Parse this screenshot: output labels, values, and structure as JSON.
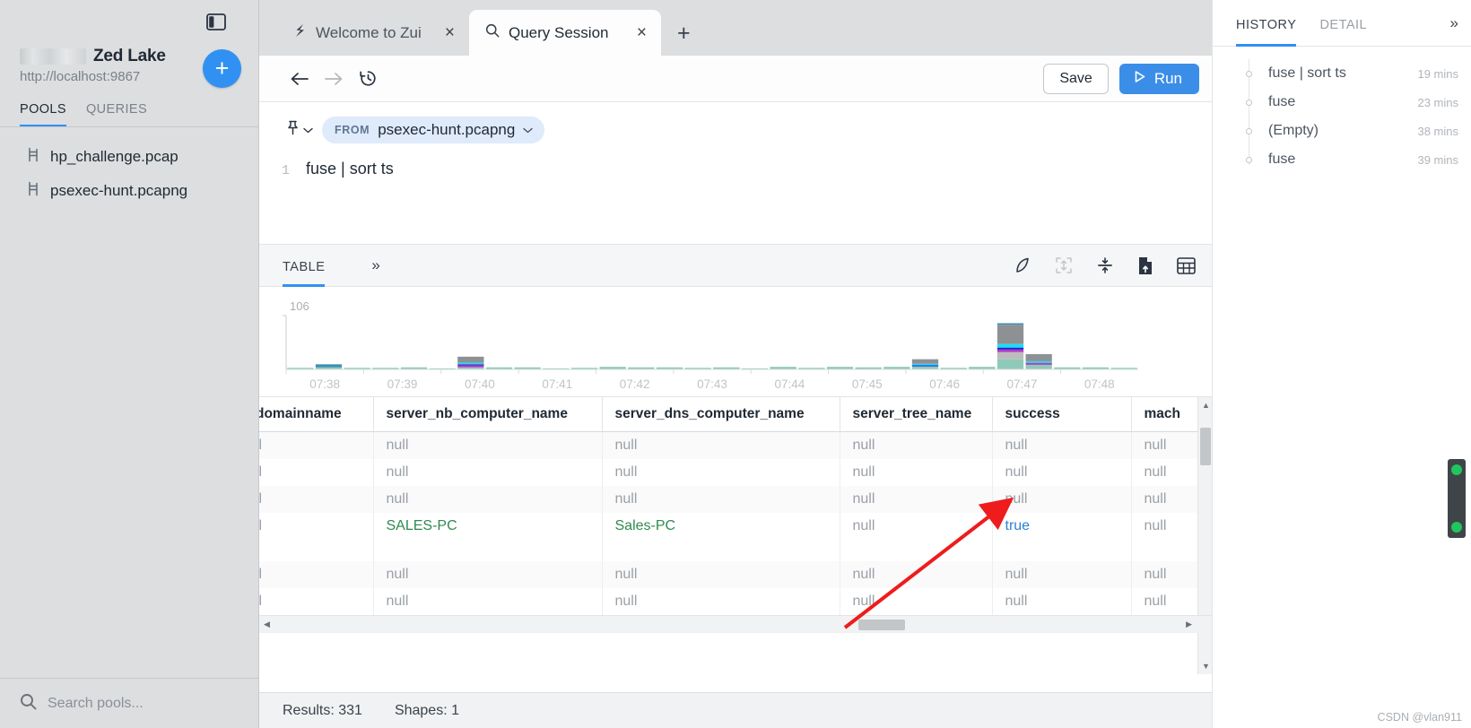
{
  "sidebar": {
    "panel_toggle_icon": "panel-toggle-icon",
    "lake_name": "Zed Lake",
    "lake_url": "http://localhost:9867",
    "add_button_label": "+",
    "tabs": [
      {
        "label": "POOLS",
        "active": true
      },
      {
        "label": "QUERIES",
        "active": false
      }
    ],
    "pools": [
      {
        "label": "hp_challenge.pcap",
        "icon": "pool-icon"
      },
      {
        "label": "psexec-hunt.pcapng",
        "icon": "pool-icon"
      }
    ],
    "search": {
      "placeholder": "Search pools...",
      "icon": "search-icon"
    }
  },
  "tabstrip": {
    "tabs": [
      {
        "label": "Welcome to Zui",
        "icon": "zui-logo-icon",
        "close": "×",
        "active": false
      },
      {
        "label": "Query Session",
        "icon": "search-icon",
        "close": "×",
        "active": true
      }
    ],
    "new_tab_label": "+"
  },
  "toolbar": {
    "back_icon": "arrow-left-icon",
    "forward_icon": "arrow-right-icon",
    "history_icon": "clock-history-icon",
    "save_label": "Save",
    "run_label": "Run",
    "run_icon": "play-icon"
  },
  "editor": {
    "pin_icon": "pin-icon",
    "pin_chevron": "chevron-down-icon",
    "from_keyword": "FROM",
    "from_value": "psexec-hunt.pcapng",
    "from_chevron": "chevron-down-icon",
    "line_number": "1",
    "query_text": "fuse | sort ts"
  },
  "results": {
    "tabs": [
      {
        "label": "TABLE",
        "active": true
      }
    ],
    "more_icon": "chevron-double-right-icon",
    "tools": [
      {
        "name": "shark-fin-icon"
      },
      {
        "name": "expand-arrows-icon"
      },
      {
        "name": "collapse-vertical-icon"
      },
      {
        "name": "export-file-icon"
      },
      {
        "name": "table-view-icon"
      }
    ],
    "columns": [
      "domainname",
      "server_nb_computer_name",
      "server_dns_computer_name",
      "server_tree_name",
      "success",
      "mach"
    ],
    "rows": [
      {
        "cells": [
          "ll",
          "null",
          "null",
          "null",
          "null",
          "null"
        ],
        "types": [
          "null",
          "null",
          "null",
          "null",
          "null",
          "null"
        ]
      },
      {
        "cells": [
          "ll",
          "null",
          "null",
          "null",
          "null",
          "null"
        ],
        "types": [
          "null",
          "null",
          "null",
          "null",
          "null",
          "null"
        ]
      },
      {
        "cells": [
          "ll",
          "null",
          "null",
          "null",
          "null",
          "null"
        ],
        "types": [
          "null",
          "null",
          "null",
          "null",
          "null",
          "null"
        ]
      },
      {
        "cells": [
          "ll",
          "SALES-PC",
          "Sales-PC",
          "null",
          "true",
          "null"
        ],
        "types": [
          "null",
          "str",
          "str",
          "null",
          "bool",
          "null"
        ]
      },
      {
        "cells": [
          "ll",
          "null",
          "null",
          "null",
          "null",
          "null"
        ],
        "types": [
          "null",
          "null",
          "null",
          "null",
          "null",
          "null"
        ]
      },
      {
        "cells": [
          "ll",
          "null",
          "null",
          "null",
          "null",
          "null"
        ],
        "types": [
          "null",
          "null",
          "null",
          "null",
          "null",
          "null"
        ]
      }
    ],
    "vscroll_up_icon": "caret-up-icon",
    "vscroll_down_icon": "caret-down-icon",
    "hscroll_left_icon": "caret-left-icon",
    "hscroll_right_icon": "caret-right-icon"
  },
  "statusbar": {
    "results_label": "Results: 331",
    "shapes_label": "Shapes: 1"
  },
  "rightpanel": {
    "tabs": [
      {
        "label": "HISTORY",
        "active": true
      },
      {
        "label": "DETAIL",
        "active": false
      }
    ],
    "expand_icon": "chevron-double-right-icon",
    "history": [
      {
        "query": "fuse | sort ts",
        "time": "19 mins"
      },
      {
        "query": "fuse",
        "time": "23 mins"
      },
      {
        "query": "(Empty)",
        "time": "38 mins"
      },
      {
        "query": "fuse",
        "time": "39 mins"
      }
    ]
  },
  "watermark": "CSDN @vlan911",
  "colors": {
    "accent": "#3091f2",
    "run_button": "#3b8ee8",
    "sidebar_bg": "#dcdee0",
    "string_value": "#2f8a4e",
    "bool_value": "#2d7fd3",
    "annotation_arrow": "#ee1c1c",
    "chart_teal": "#8fcab8",
    "chart_gray": "#8e9194",
    "chart_cyan": "#16e0f5",
    "chart_blue": "#2a1fd6",
    "chart_purple": "#b03fc0",
    "chart_lightgray": "#bcbcbc",
    "chart_steelblue": "#3f8fb5"
  },
  "chart_data": {
    "type": "bar",
    "stacked": true,
    "title": "",
    "xlabel": "",
    "ylabel": "",
    "ylim": [
      0,
      106
    ],
    "ymax_label": "106",
    "grid": false,
    "legend": "none",
    "tick_labels": [
      "07:38",
      "07:39",
      "07:40",
      "07:41",
      "07:42",
      "07:43",
      "07:44",
      "07:45",
      "07:46",
      "07:47",
      "07:48"
    ],
    "series": [
      {
        "name": "teal",
        "color": "#8fcab8",
        "values": [
          3,
          4,
          3,
          3,
          4,
          2,
          4,
          4,
          4,
          2,
          3,
          5,
          4,
          4,
          3,
          4,
          2,
          5,
          3,
          5,
          4,
          5,
          6,
          3,
          5,
          20,
          9,
          4,
          4,
          3
        ]
      },
      {
        "name": "lightgray",
        "color": "#bcbcbc",
        "values": [
          0,
          0,
          0,
          0,
          0,
          0,
          0,
          0,
          0,
          0,
          0,
          0,
          0,
          0,
          0,
          0,
          0,
          0,
          0,
          0,
          0,
          0,
          0,
          0,
          0,
          14,
          0,
          0,
          0,
          0
        ]
      },
      {
        "name": "purple",
        "color": "#b03fc0",
        "values": [
          0,
          0,
          0,
          0,
          0,
          0,
          4,
          0,
          0,
          0,
          0,
          0,
          0,
          0,
          0,
          0,
          0,
          0,
          0,
          0,
          0,
          0,
          0,
          0,
          0,
          5,
          4,
          0,
          0,
          0
        ]
      },
      {
        "name": "blue",
        "color": "#2a1fd6",
        "values": [
          0,
          0,
          0,
          0,
          0,
          0,
          2,
          0,
          0,
          0,
          0,
          0,
          0,
          0,
          0,
          0,
          0,
          0,
          0,
          0,
          0,
          0,
          2,
          0,
          0,
          4,
          0,
          0,
          0,
          0
        ]
      },
      {
        "name": "cyan",
        "color": "#16e0f5",
        "values": [
          0,
          0,
          0,
          0,
          0,
          0,
          3,
          0,
          0,
          0,
          0,
          0,
          0,
          0,
          0,
          0,
          0,
          0,
          0,
          0,
          0,
          0,
          3,
          0,
          0,
          7,
          3,
          0,
          0,
          0
        ]
      },
      {
        "name": "gray",
        "color": "#8e9194",
        "values": [
          0,
          0,
          0,
          0,
          0,
          0,
          12,
          0,
          0,
          0,
          0,
          0,
          0,
          0,
          0,
          0,
          0,
          0,
          0,
          0,
          0,
          0,
          9,
          0,
          0,
          38,
          14,
          0,
          0,
          0
        ]
      },
      {
        "name": "steelblue",
        "color": "#3f8fb5",
        "values": [
          0,
          6,
          0,
          0,
          0,
          0,
          0,
          0,
          0,
          0,
          0,
          0,
          0,
          0,
          0,
          0,
          0,
          0,
          0,
          0,
          0,
          0,
          0,
          0,
          0,
          3,
          0,
          0,
          0,
          0
        ]
      }
    ]
  }
}
